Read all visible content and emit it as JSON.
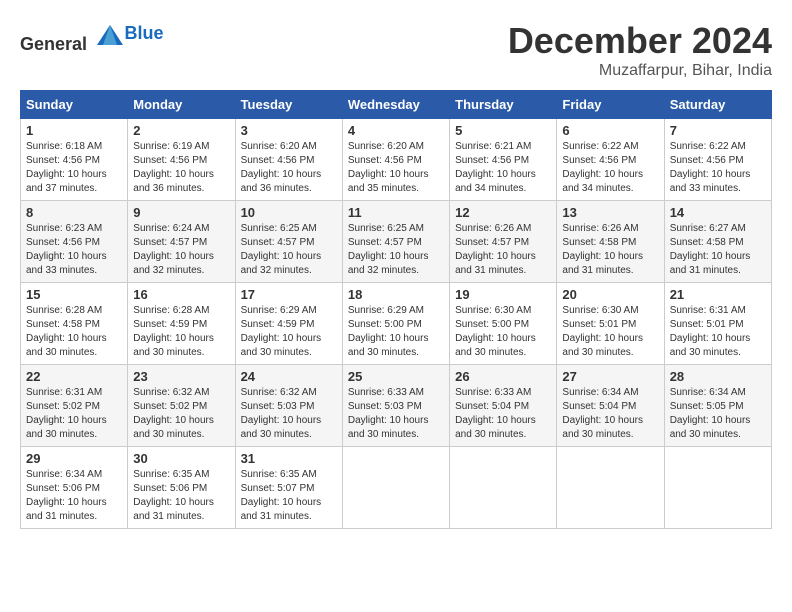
{
  "header": {
    "logo_general": "General",
    "logo_blue": "Blue",
    "title": "December 2024",
    "location": "Muzaffarpur, Bihar, India"
  },
  "calendar": {
    "days_of_week": [
      "Sunday",
      "Monday",
      "Tuesday",
      "Wednesday",
      "Thursday",
      "Friday",
      "Saturday"
    ],
    "weeks": [
      [
        null,
        null,
        null,
        null,
        null,
        null,
        null
      ]
    ],
    "cells": [
      {
        "day": null,
        "sunrise": null,
        "sunset": null,
        "daylight": null
      },
      {
        "day": 1,
        "sunrise": "6:18 AM",
        "sunset": "4:56 PM",
        "daylight": "10 hours and 37 minutes."
      },
      {
        "day": 2,
        "sunrise": "6:19 AM",
        "sunset": "4:56 PM",
        "daylight": "10 hours and 36 minutes."
      },
      {
        "day": 3,
        "sunrise": "6:20 AM",
        "sunset": "4:56 PM",
        "daylight": "10 hours and 36 minutes."
      },
      {
        "day": 4,
        "sunrise": "6:20 AM",
        "sunset": "4:56 PM",
        "daylight": "10 hours and 35 minutes."
      },
      {
        "day": 5,
        "sunrise": "6:21 AM",
        "sunset": "4:56 PM",
        "daylight": "10 hours and 34 minutes."
      },
      {
        "day": 6,
        "sunrise": "6:22 AM",
        "sunset": "4:56 PM",
        "daylight": "10 hours and 34 minutes."
      },
      {
        "day": 7,
        "sunrise": "6:22 AM",
        "sunset": "4:56 PM",
        "daylight": "10 hours and 33 minutes."
      },
      {
        "day": 8,
        "sunrise": "6:23 AM",
        "sunset": "4:56 PM",
        "daylight": "10 hours and 33 minutes."
      },
      {
        "day": 9,
        "sunrise": "6:24 AM",
        "sunset": "4:57 PM",
        "daylight": "10 hours and 32 minutes."
      },
      {
        "day": 10,
        "sunrise": "6:25 AM",
        "sunset": "4:57 PM",
        "daylight": "10 hours and 32 minutes."
      },
      {
        "day": 11,
        "sunrise": "6:25 AM",
        "sunset": "4:57 PM",
        "daylight": "10 hours and 32 minutes."
      },
      {
        "day": 12,
        "sunrise": "6:26 AM",
        "sunset": "4:57 PM",
        "daylight": "10 hours and 31 minutes."
      },
      {
        "day": 13,
        "sunrise": "6:26 AM",
        "sunset": "4:58 PM",
        "daylight": "10 hours and 31 minutes."
      },
      {
        "day": 14,
        "sunrise": "6:27 AM",
        "sunset": "4:58 PM",
        "daylight": "10 hours and 31 minutes."
      },
      {
        "day": 15,
        "sunrise": "6:28 AM",
        "sunset": "4:58 PM",
        "daylight": "10 hours and 30 minutes."
      },
      {
        "day": 16,
        "sunrise": "6:28 AM",
        "sunset": "4:59 PM",
        "daylight": "10 hours and 30 minutes."
      },
      {
        "day": 17,
        "sunrise": "6:29 AM",
        "sunset": "4:59 PM",
        "daylight": "10 hours and 30 minutes."
      },
      {
        "day": 18,
        "sunrise": "6:29 AM",
        "sunset": "5:00 PM",
        "daylight": "10 hours and 30 minutes."
      },
      {
        "day": 19,
        "sunrise": "6:30 AM",
        "sunset": "5:00 PM",
        "daylight": "10 hours and 30 minutes."
      },
      {
        "day": 20,
        "sunrise": "6:30 AM",
        "sunset": "5:01 PM",
        "daylight": "10 hours and 30 minutes."
      },
      {
        "day": 21,
        "sunrise": "6:31 AM",
        "sunset": "5:01 PM",
        "daylight": "10 hours and 30 minutes."
      },
      {
        "day": 22,
        "sunrise": "6:31 AM",
        "sunset": "5:02 PM",
        "daylight": "10 hours and 30 minutes."
      },
      {
        "day": 23,
        "sunrise": "6:32 AM",
        "sunset": "5:02 PM",
        "daylight": "10 hours and 30 minutes."
      },
      {
        "day": 24,
        "sunrise": "6:32 AM",
        "sunset": "5:03 PM",
        "daylight": "10 hours and 30 minutes."
      },
      {
        "day": 25,
        "sunrise": "6:33 AM",
        "sunset": "5:03 PM",
        "daylight": "10 hours and 30 minutes."
      },
      {
        "day": 26,
        "sunrise": "6:33 AM",
        "sunset": "5:04 PM",
        "daylight": "10 hours and 30 minutes."
      },
      {
        "day": 27,
        "sunrise": "6:34 AM",
        "sunset": "5:04 PM",
        "daylight": "10 hours and 30 minutes."
      },
      {
        "day": 28,
        "sunrise": "6:34 AM",
        "sunset": "5:05 PM",
        "daylight": "10 hours and 30 minutes."
      },
      {
        "day": 29,
        "sunrise": "6:34 AM",
        "sunset": "5:06 PM",
        "daylight": "10 hours and 31 minutes."
      },
      {
        "day": 30,
        "sunrise": "6:35 AM",
        "sunset": "5:06 PM",
        "daylight": "10 hours and 31 minutes."
      },
      {
        "day": 31,
        "sunrise": "6:35 AM",
        "sunset": "5:07 PM",
        "daylight": "10 hours and 31 minutes."
      }
    ]
  }
}
